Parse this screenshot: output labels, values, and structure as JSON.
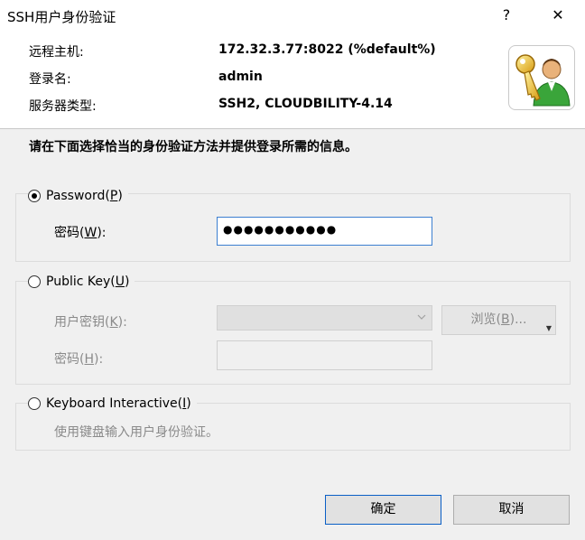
{
  "window": {
    "title": "SSH用户身份验证",
    "help_glyph": "?",
    "close_glyph": "✕"
  },
  "header": {
    "host_label": "远程主机:",
    "host_value": "172.32.3.77:8022 (%default%)",
    "login_label": "登录名:",
    "login_value": "admin",
    "server_label": "服务器类型:",
    "server_value": "SSH2, CLOUDBILITY-4.14"
  },
  "instruction": "请在下面选择恰当的身份验证方法并提供登录所需的信息。",
  "password_group": {
    "radio_label": "Password(",
    "radio_key": "P",
    "radio_suffix": ")",
    "selected": true,
    "field_label": "密码(",
    "field_key": "W",
    "field_suffix": "):",
    "field_value": "●●●●●●●●●●●"
  },
  "pubkey_group": {
    "radio_label": "Public Key(",
    "radio_key": "U",
    "radio_suffix": ")",
    "user_key_label": "用户密钥(",
    "user_key_key": "K",
    "user_key_suffix": "):",
    "browse_label": "浏览(",
    "browse_key": "B",
    "browse_suffix": ")...",
    "passphrase_label": "密码(",
    "passphrase_key": "H",
    "passphrase_suffix": "):"
  },
  "kbd_group": {
    "radio_label": "Keyboard Interactive(",
    "radio_key": "I",
    "radio_suffix": ")",
    "description": "使用键盘输入用户身份验证。"
  },
  "buttons": {
    "ok": "确定",
    "cancel": "取消"
  },
  "icons": {
    "logo": "key-user-icon",
    "dropdown": "chevron-down-icon"
  },
  "colors": {
    "accent": "#0a5fc6",
    "focus_border": "#3c7fd0"
  }
}
